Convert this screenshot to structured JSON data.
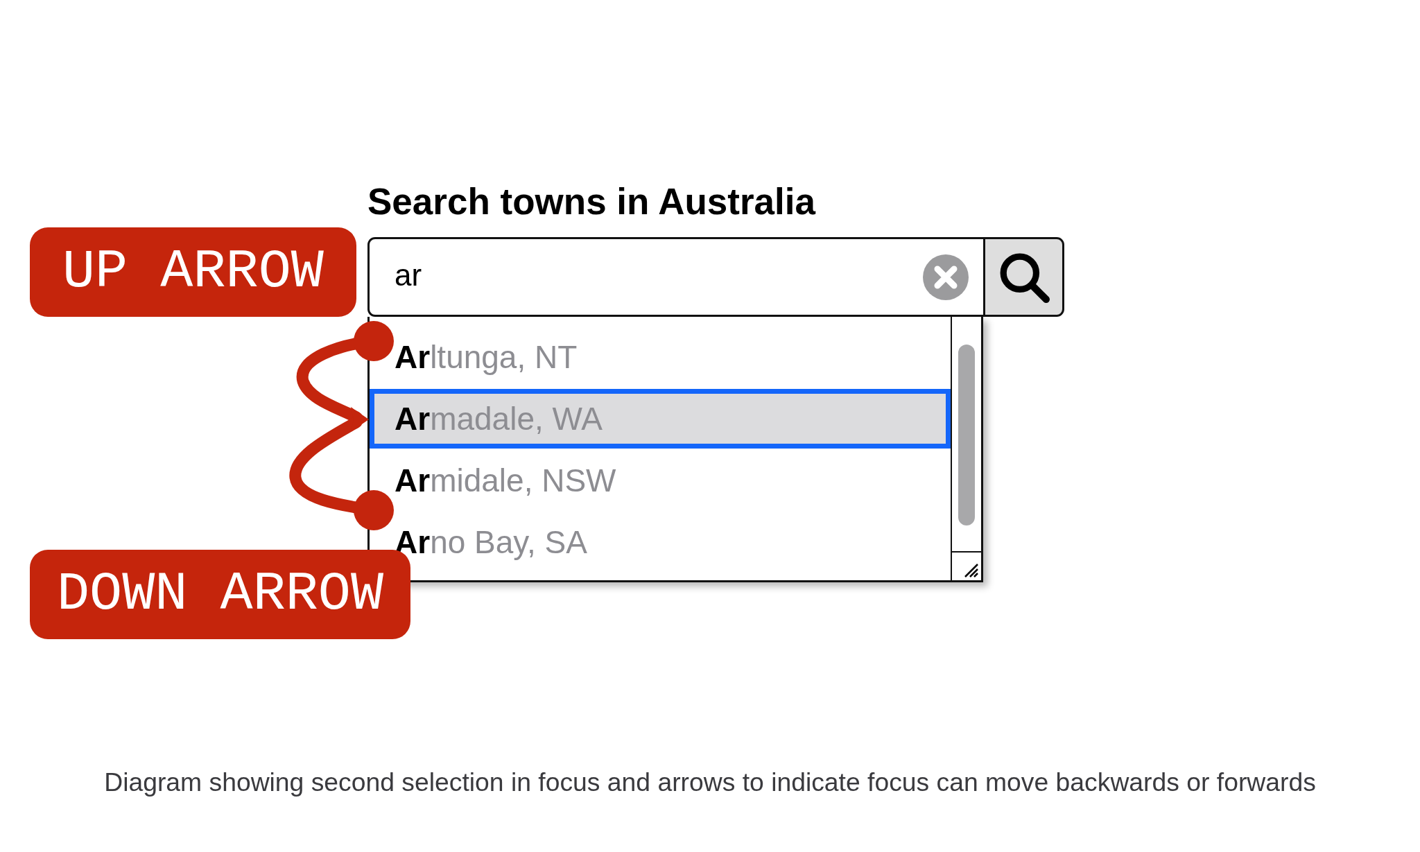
{
  "heading": "Search towns in Australia",
  "search": {
    "value": "ar"
  },
  "suggestions": [
    {
      "label": "**Ar**ltunga, NT",
      "selected": false
    },
    {
      "label": "**Ar**madale, WA",
      "selected": true
    },
    {
      "label": "**Ar**midale, NSW",
      "selected": false
    },
    {
      "label": "**Ar**no Bay, SA",
      "selected": false
    }
  ],
  "annotations": [
    {
      "kind": "up",
      "label": "UP ARROW"
    },
    {
      "kind": "down",
      "label": "DOWN ARROW"
    }
  ],
  "caption": "Diagram showing second selection in focus and arrows to indicate focus can move backwards or forwards"
}
